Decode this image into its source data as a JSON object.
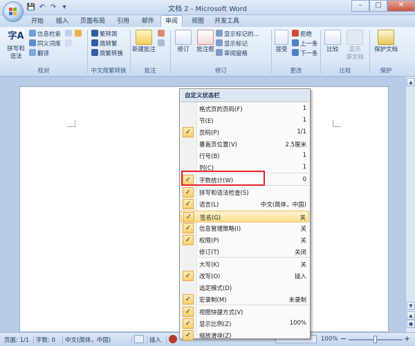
{
  "window": {
    "title": "文档 2 - Microsoft Word",
    "minimize": "–",
    "maximize": "□",
    "close": "✕"
  },
  "qat": {
    "save": "💾",
    "undo": "↶",
    "redo": "↷",
    "more": "▾"
  },
  "tabs": [
    "开始",
    "插入",
    "页面布局",
    "引用",
    "邮件",
    "审阅",
    "视图",
    "开发工具"
  ],
  "active_tab": "审阅",
  "ribbon": {
    "proofing": {
      "label": "校对",
      "big": "拼写和\n语法",
      "items": [
        "信息检索",
        "同义词库",
        "翻译"
      ]
    },
    "chinese": {
      "label": "中文简繁转换",
      "items": [
        "繁转简",
        "简转繁",
        "简繁转换"
      ]
    },
    "comments": {
      "label": "批注",
      "big": "新建批注"
    },
    "tracking": {
      "label": "修订",
      "big1": "修订",
      "big2": "批注框",
      "items": [
        "显示标记的...",
        "显示标记",
        "审阅窗格"
      ]
    },
    "changes": {
      "label": "更改",
      "big": "接受",
      "items": [
        "拒绝",
        "上一条",
        "下一条"
      ]
    },
    "compare": {
      "label": "比较",
      "big1": "比较",
      "big2": "显示\n源文档"
    },
    "protect": {
      "label": "保护",
      "big": "保护文档"
    }
  },
  "menu": {
    "title": "自定义状态栏",
    "items": [
      {
        "label": "格式页的页码(F)",
        "value": "1",
        "checked": false
      },
      {
        "label": "节(E)",
        "value": "1",
        "checked": false
      },
      {
        "label": "页码(P)",
        "value": "1/1",
        "checked": true
      },
      {
        "label": "垂直页位置(V)",
        "value": "2.5厘米",
        "checked": false
      },
      {
        "label": "行号(B)",
        "value": "1",
        "checked": false
      },
      {
        "label": "列(C)",
        "value": "1",
        "checked": false
      },
      {
        "label": "字数统计(W)",
        "value": "0",
        "checked": true
      },
      {
        "label": "拼写和语法检查(S)",
        "value": "",
        "checked": true
      },
      {
        "label": "语言(L)",
        "value": "中文(简体，中国)",
        "checked": true
      },
      {
        "label": "签名(G)",
        "value": "关",
        "checked": true
      },
      {
        "label": "信息管理策略(I)",
        "value": "关",
        "checked": true
      },
      {
        "label": "权限(P)",
        "value": "关",
        "checked": true
      },
      {
        "label": "修订(T)",
        "value": "关闭",
        "checked": false
      },
      {
        "label": "大写(K)",
        "value": "关",
        "checked": false
      },
      {
        "label": "改写(O)",
        "value": "插入",
        "checked": true
      },
      {
        "label": "选定模式(D)",
        "value": "",
        "checked": false
      },
      {
        "label": "宏录制(M)",
        "value": "未录制",
        "checked": true
      },
      {
        "label": "视图快捷方式(V)",
        "value": "",
        "checked": true
      },
      {
        "label": "显示比例(Z)",
        "value": "100%",
        "checked": true
      },
      {
        "label": "缩放滑块(Z)",
        "value": "",
        "checked": true
      }
    ],
    "highlighted_index": 9,
    "check_glyph": "✓"
  },
  "status": {
    "page": "页面: 1/1",
    "words": "字数: 0",
    "language": "中文(简体，中国)",
    "mode": "插入",
    "zoom": "100%",
    "zoom_minus": "−",
    "zoom_plus": "+"
  },
  "colors": {
    "accent": "#1e395b",
    "highlight_box": "#e5212a",
    "menu_highlight": "#fddf8e"
  }
}
